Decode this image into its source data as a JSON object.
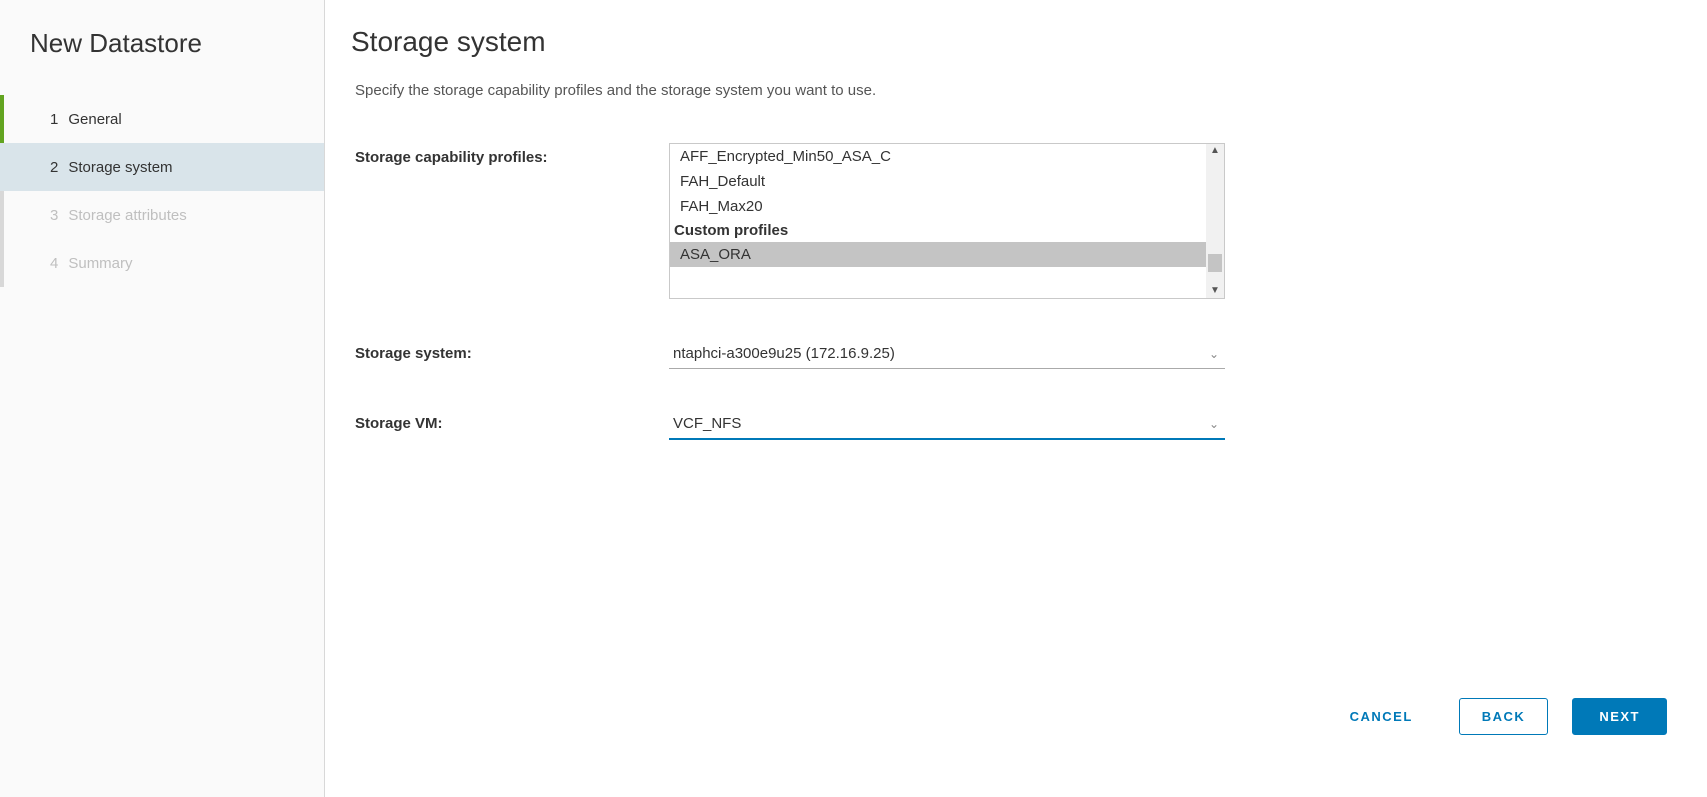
{
  "sidebar": {
    "title": "New Datastore",
    "steps": [
      {
        "num": "1",
        "label": "General",
        "state": "completed"
      },
      {
        "num": "2",
        "label": "Storage system",
        "state": "active"
      },
      {
        "num": "3",
        "label": "Storage attributes",
        "state": "pending"
      },
      {
        "num": "4",
        "label": "Summary",
        "state": "pending"
      }
    ]
  },
  "main": {
    "title": "Storage system",
    "subtitle": "Specify the storage capability profiles and the storage system you want to use.",
    "labels": {
      "profiles": "Storage capability profiles:",
      "system": "Storage system:",
      "vm": "Storage VM:"
    },
    "profiles": {
      "items": [
        "AFF_Encrypted_Min50_ASA_C",
        "FAH_Default",
        "FAH_Max20"
      ],
      "customHeader": "Custom profiles",
      "custom": [
        "ASA_ORA"
      ],
      "selected": "ASA_ORA"
    },
    "system_value": "ntaphci-a300e9u25 (172.16.9.25)",
    "vm_value": "VCF_NFS"
  },
  "buttons": {
    "cancel": "CANCEL",
    "back": "BACK",
    "next": "NEXT"
  }
}
